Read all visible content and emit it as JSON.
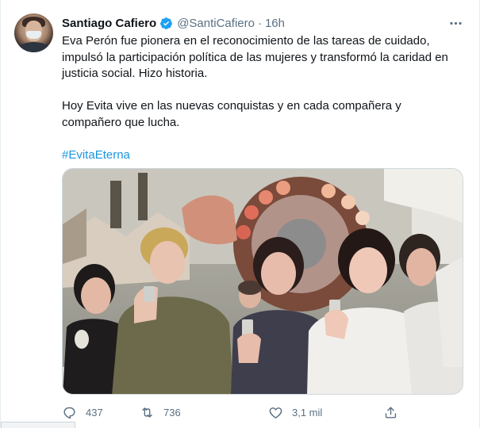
{
  "tweet": {
    "author_name": "Santiago Cafiero",
    "handle": "@SantiCafiero",
    "separator": "·",
    "time": "16h",
    "paragraph1": "Eva Perón fue pionera en el reconocimiento de las tareas de cuidado, impulsó la participación política de las mujeres y transformó la caridad en justicia social. Hizo historia.",
    "paragraph2": "Hoy Evita vive en las nuevas conquistas y en cada compañera y compañero que lucha.",
    "hashtag": "#EvitaEterna",
    "verified_color": "#1da1f2",
    "link_color": "#1b95e0"
  },
  "actions": {
    "reply_count": "437",
    "retweet_count": "736",
    "like_count": "3,1 mil"
  },
  "icons": {
    "more": "more-horizontal-icon",
    "reply": "reply-icon",
    "retweet": "retweet-icon",
    "like": "heart-icon",
    "share": "share-icon",
    "verified": "verified-badge-icon"
  }
}
